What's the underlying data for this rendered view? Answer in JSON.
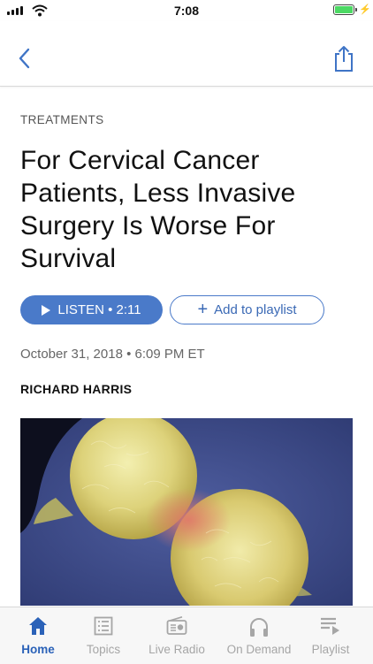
{
  "status_bar": {
    "time": "7:08"
  },
  "article": {
    "category": "TREATMENTS",
    "headline": "For Cervical Cancer Patients, Less Invasive Surgery Is Worse For Survival",
    "listen_label": "LISTEN • 2:11",
    "playlist_label": "Add to playlist",
    "date": "October 31, 2018 • 6:09 PM ET",
    "author": "RICHARD HARRIS"
  },
  "tab_bar": {
    "tabs": [
      {
        "label": "Home",
        "icon": "home-icon",
        "active": true
      },
      {
        "label": "Topics",
        "icon": "topics-icon",
        "active": false
      },
      {
        "label": "Live Radio",
        "icon": "radio-icon",
        "active": false
      },
      {
        "label": "On Demand",
        "icon": "headphones-icon",
        "active": false
      },
      {
        "label": "Playlist",
        "icon": "playlist-icon",
        "active": false
      }
    ]
  },
  "colors": {
    "accent": "#4a7ac9",
    "active_tab": "#2b62b8",
    "inactive_tab": "#a6a6a6"
  }
}
